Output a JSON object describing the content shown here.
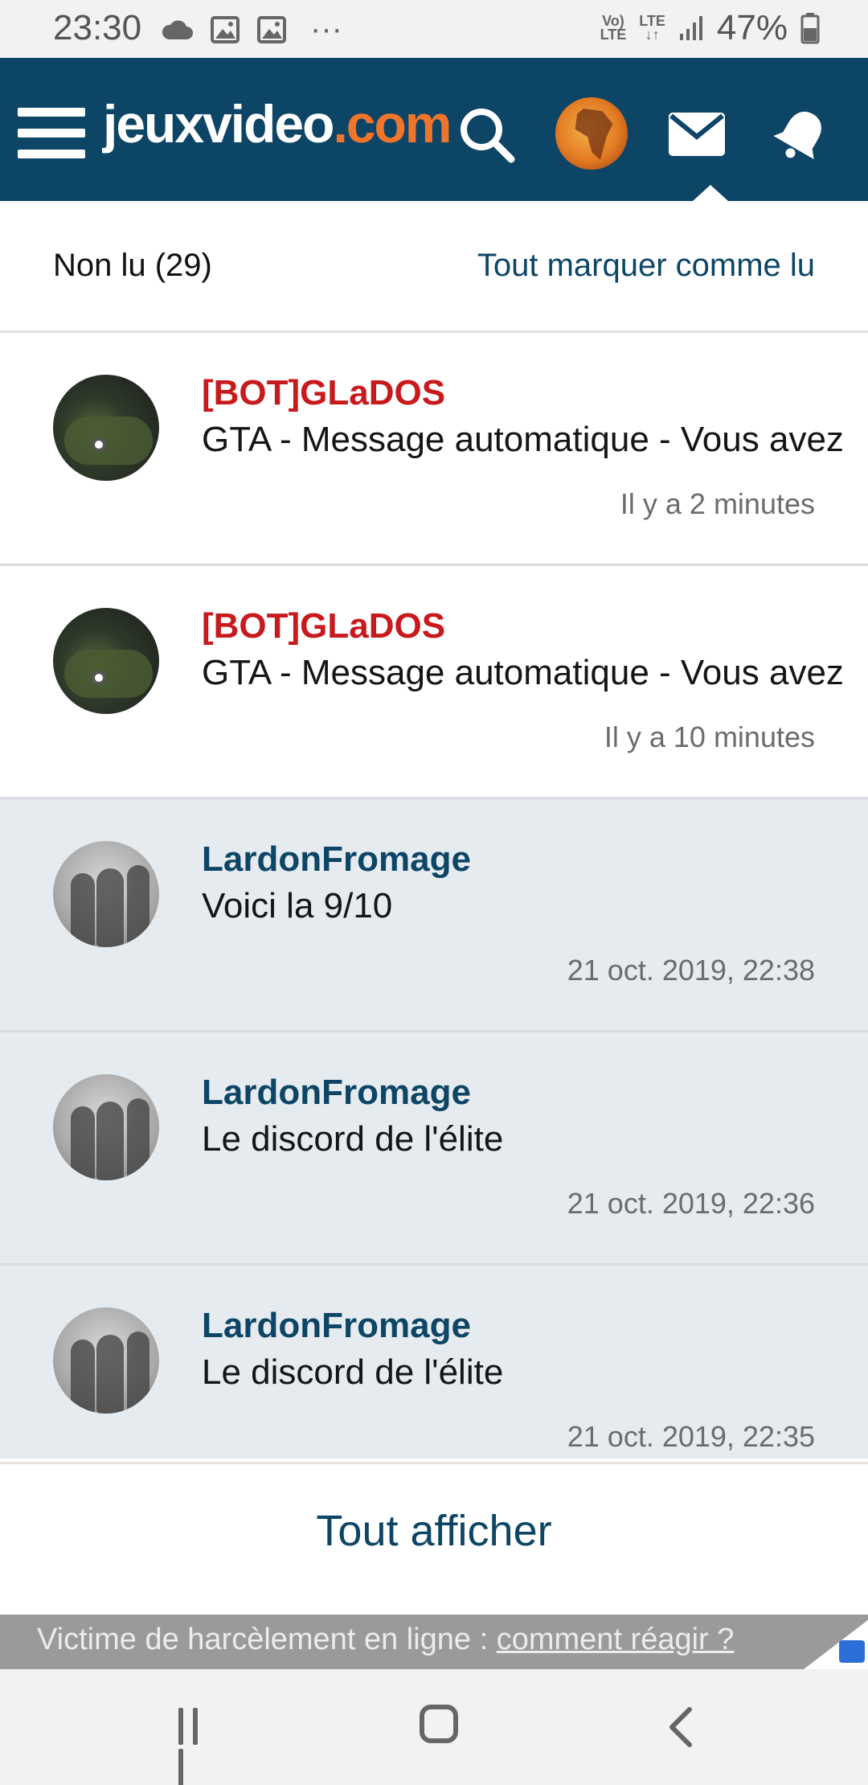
{
  "status_bar": {
    "time": "23:30",
    "dots": "···",
    "volte": "Vo)\nLTE",
    "lte": "LTE",
    "battery": "47%"
  },
  "header": {
    "logo_main": "jeuxvideo",
    "logo_domain": ".com",
    "icons": [
      "menu-icon",
      "search-icon",
      "user-avatar",
      "mail-icon",
      "bell-icon"
    ],
    "brand_color": "#0c4566",
    "accent_color": "#f0752b"
  },
  "inbox": {
    "unread_label": "Non lu (29)",
    "mark_all_label": "Tout marquer comme lu",
    "messages": [
      {
        "author": "[BOT]GLaDOS",
        "subject": "GTA - Message automatique - Vous avez",
        "date": "Il y a 2 minutes",
        "read": true
      },
      {
        "author": "[BOT]GLaDOS",
        "subject": "GTA - Message automatique - Vous avez",
        "date": "Il y a 10 minutes",
        "read": true
      },
      {
        "author": "LardonFromage",
        "subject": "Voici la 9/10",
        "date": "21 oct. 2019, 22:38",
        "read": false
      },
      {
        "author": "LardonFromage",
        "subject": "Le discord de l'élite",
        "date": "21 oct. 2019, 22:36",
        "read": false
      },
      {
        "author": "LardonFromage",
        "subject": "Le discord de l'élite",
        "date": "21 oct. 2019, 22:35",
        "read": false
      }
    ],
    "show_all_label": "Tout afficher"
  },
  "banner": {
    "text": "Victime de harcèlement en ligne : ",
    "link": "comment réagir ?"
  },
  "nav": {
    "icons": [
      "recent-apps-icon",
      "home-icon",
      "back-icon"
    ]
  }
}
